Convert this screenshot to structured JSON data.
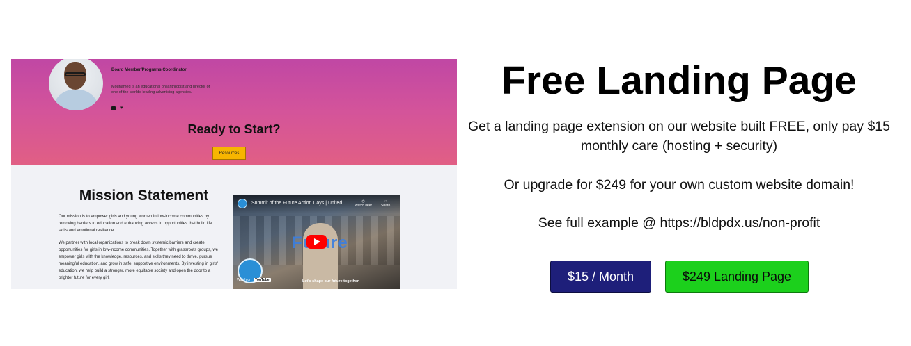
{
  "preview": {
    "member_role": "Board Member/Programs Coordinator",
    "member_bio": "Mouhamed is an educational philanthropist and director of one of the world's leading advertising agencies.",
    "ready_heading": "Ready to Start?",
    "resources_label": "Resources",
    "mission_title": "Mission Statement",
    "mission_p1": "Our mission is to empower girls and young women in low-income communities by removing barriers to education and enhancing access to opportunities that build life skills and emotional resilience.",
    "mission_p2": "We partner with local organizations to break down systemic barriers and create opportunities for girls in low-income communities. Together with grassroots groups, we empower girls with the knowledge, resources, and skills they need to thrive, pursue meaningful education, and grow in safe, supportive environments. By investing in girls' education, we help build a stronger, more equitable society and open the door to a brighter future for every girl.",
    "video": {
      "title": "Summit of the Future Action Days | United ...",
      "watch_later": "Watch later",
      "share": "Share",
      "overlay_text": "Future",
      "watch_on": "Watch on",
      "youtube": "YouTube",
      "caption": "Let's shape our future together."
    }
  },
  "main": {
    "title": "Free Landing Page",
    "paragraph1": "Get a landing page extension on our website built FREE, only pay $15 monthly care (hosting + security)",
    "paragraph2": "Or upgrade for $249 for your own custom website domain!",
    "paragraph3": "See full example @ https://bldpdx.us/non-profit"
  },
  "buttons": {
    "monthly_label": "$15 / Month",
    "landing_label": "$249 Landing Page"
  },
  "colors": {
    "monthly_button": "#1e1f7a",
    "landing_button": "#1cd01c",
    "resources_button": "#f7b500",
    "hero_gradient_top": "#c047a4",
    "hero_gradient_bottom": "#e15f84"
  }
}
